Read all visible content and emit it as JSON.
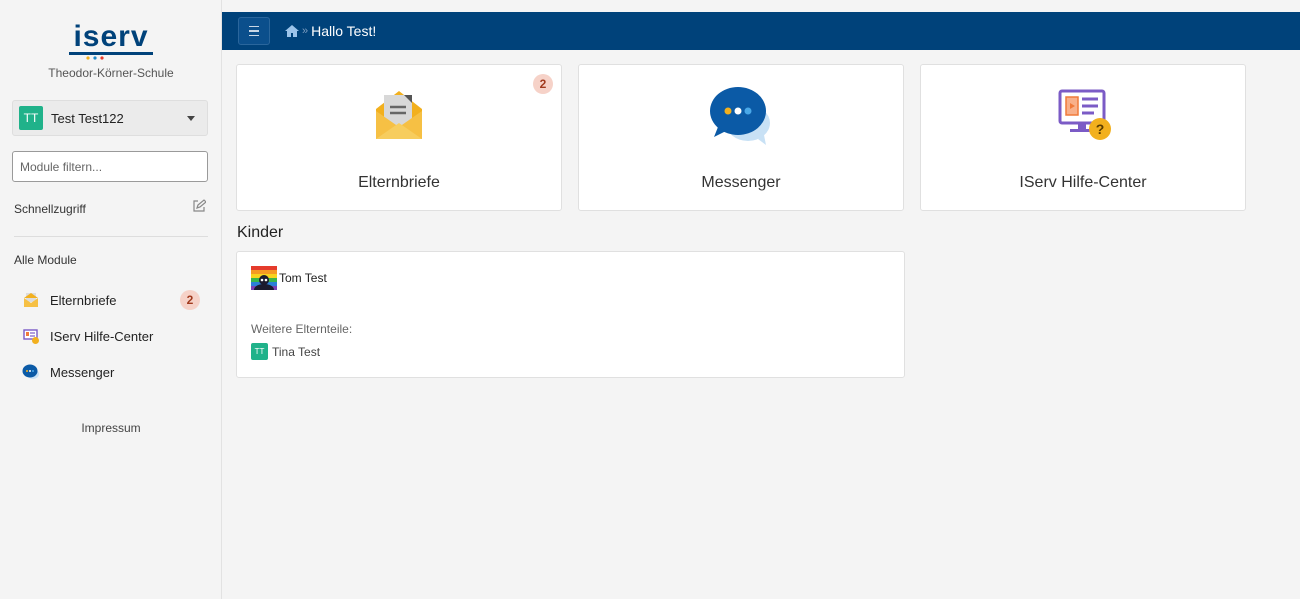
{
  "brand": {
    "logo_text": "ISERV",
    "school": "Theodor-Körner-Schule",
    "accent": "#00427a"
  },
  "user": {
    "initials": "TT",
    "name": "Test Test122",
    "avatar_color": "#20b28a"
  },
  "filter": {
    "placeholder": "Module filtern..."
  },
  "sidebar": {
    "quick_access": "Schnellzugriff",
    "all_modules": "Alle Module",
    "modules": [
      {
        "label": "Elternbriefe",
        "icon": "envelope-letter-icon",
        "badge": "2"
      },
      {
        "label": "IServ Hilfe-Center",
        "icon": "help-center-icon"
      },
      {
        "label": "Messenger",
        "icon": "chat-bubble-icon"
      }
    ],
    "impressum": "Impressum"
  },
  "topbar": {
    "menu_icon": "hamburger-icon",
    "home_icon": "home-icon",
    "separator": "»",
    "title": "Hallo Test!"
  },
  "tiles": [
    {
      "label": "Elternbriefe",
      "icon": "envelope-letter-icon",
      "badge": "2"
    },
    {
      "label": "Messenger",
      "icon": "chat-bubble-icon"
    },
    {
      "label": "IServ Hilfe-Center",
      "icon": "help-center-icon"
    }
  ],
  "kinder": {
    "heading": "Kinder",
    "child_name": "Tom Test",
    "other_parents_label": "Weitere Elternteile:",
    "parent_initials": "TT",
    "parent_name": "Tina Test"
  }
}
